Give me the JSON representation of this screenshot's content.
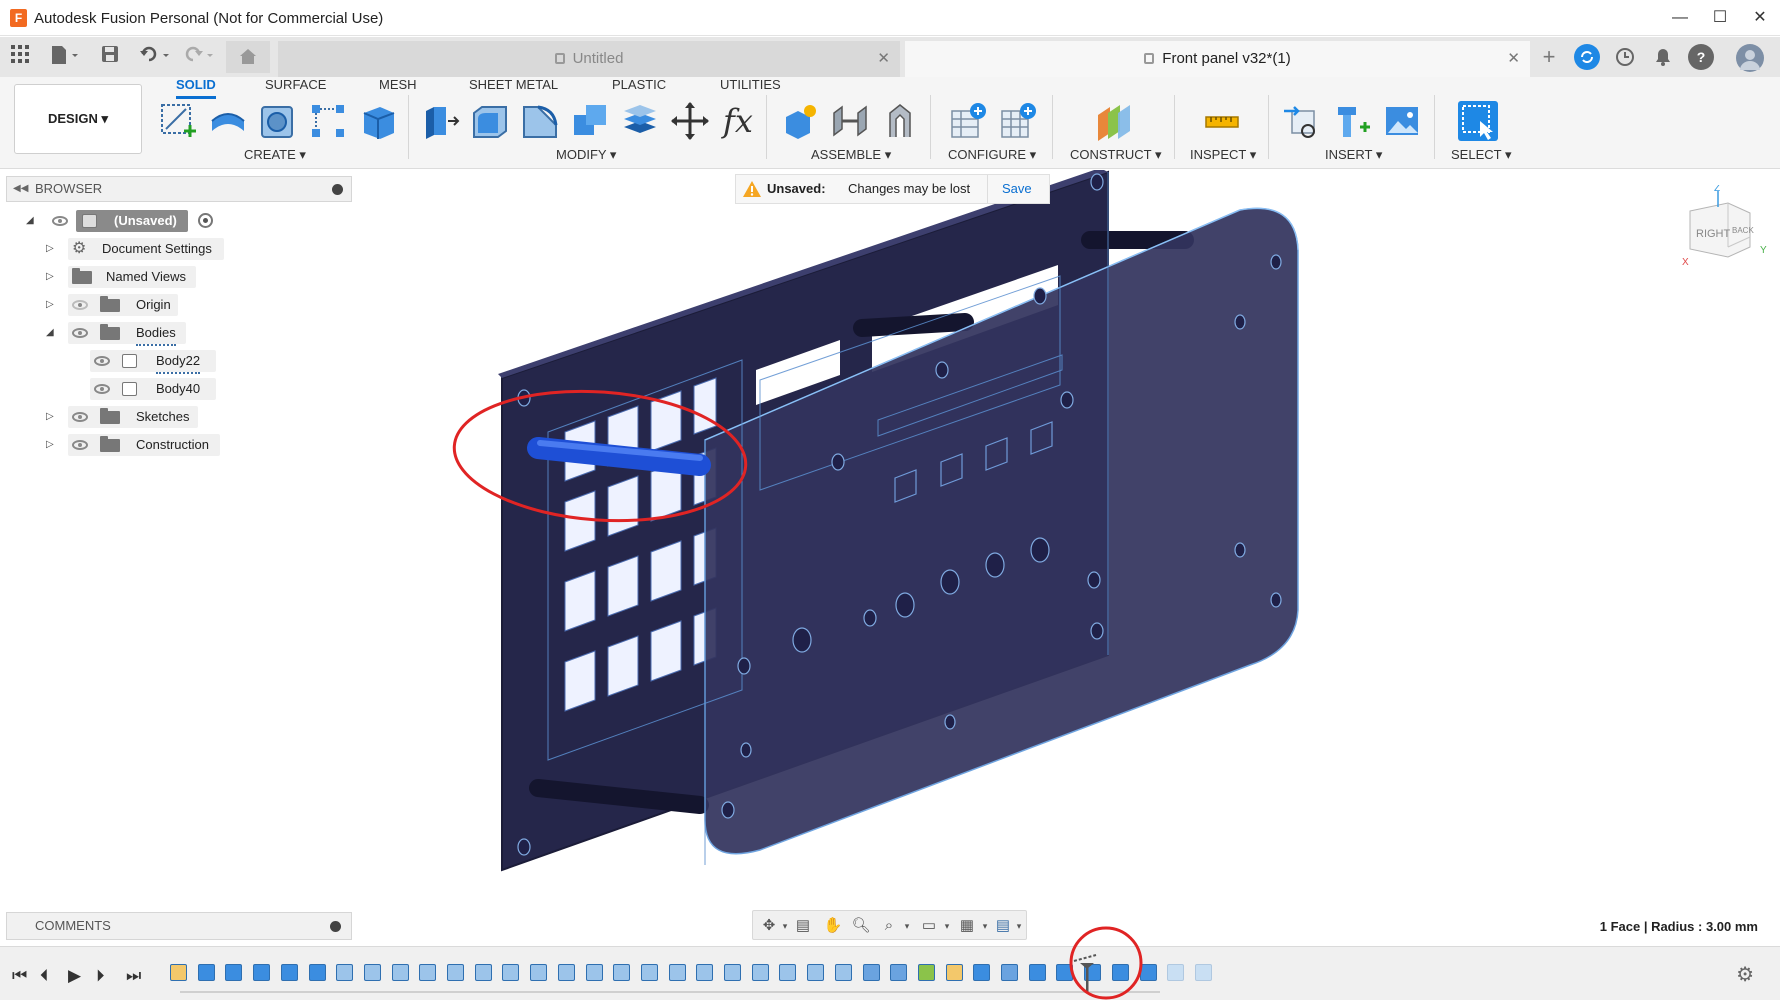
{
  "window": {
    "title": "Autodesk Fusion Personal (Not for Commercial Use)",
    "app_icon_letter": "F",
    "controls": [
      "—",
      "☐",
      "✕"
    ]
  },
  "tabs": [
    {
      "label": "Untitled",
      "locked": true,
      "active": false
    },
    {
      "label": "Front panel v32*(1)",
      "locked": true,
      "active": true
    }
  ],
  "ribbon": {
    "workspace": "DESIGN ▾",
    "tabs": [
      "SOLID",
      "SURFACE",
      "MESH",
      "SHEET METAL",
      "PLASTIC",
      "UTILITIES"
    ],
    "active_tab": "SOLID",
    "groups": [
      "CREATE ▾",
      "MODIFY ▾",
      "ASSEMBLE ▾",
      "CONFIGURE ▾",
      "CONSTRUCT ▾",
      "INSPECT ▾",
      "INSERT ▾",
      "SELECT ▾"
    ],
    "fx_label": "fx"
  },
  "browser": {
    "title": "BROWSER",
    "items": [
      {
        "label": "(Unsaved)"
      },
      {
        "label": "Document Settings"
      },
      {
        "label": "Named Views"
      },
      {
        "label": "Origin"
      },
      {
        "label": "Bodies"
      },
      {
        "label": "Body22"
      },
      {
        "label": "Body40"
      },
      {
        "label": "Sketches"
      },
      {
        "label": "Construction"
      }
    ]
  },
  "unsaved_bar": {
    "label": "Unsaved:",
    "message": "Changes may be lost",
    "save": "Save"
  },
  "viewcube": {
    "face": "RIGHT",
    "side": "BACK",
    "axes": [
      "Z",
      "X",
      "Y"
    ]
  },
  "comments": {
    "title": "COMMENTS"
  },
  "status": {
    "measure": "1 Face | Radius : 3.00 mm"
  },
  "colors": {
    "accent": "#0a6fd1",
    "panel": "#33345e",
    "panel_dark": "#25264a",
    "highlight": "#1e4fd6",
    "annotation": "#e02424"
  }
}
